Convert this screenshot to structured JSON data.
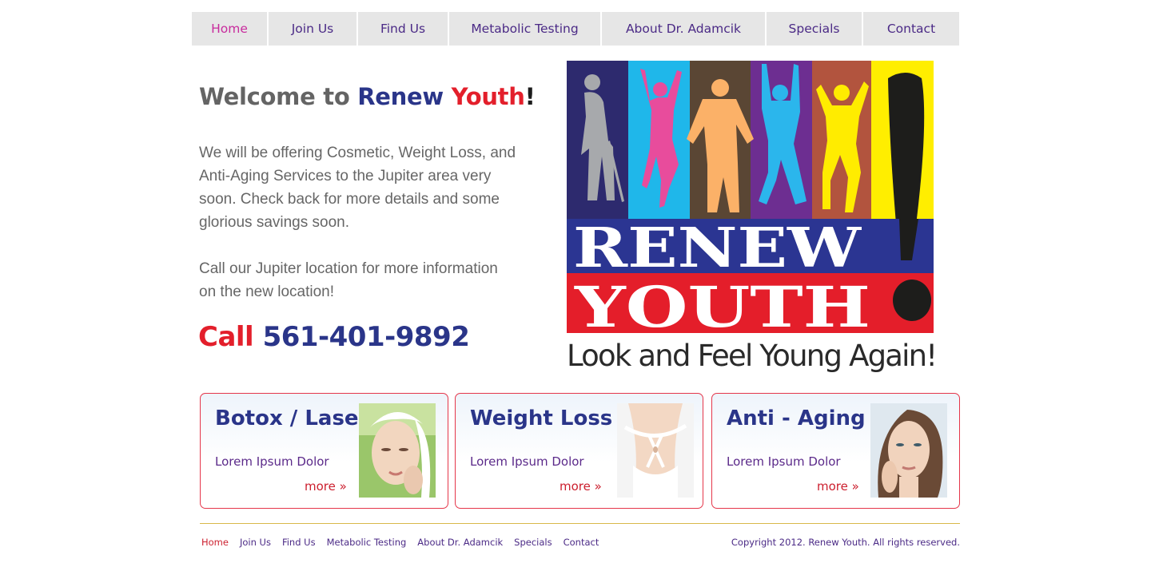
{
  "nav": {
    "items": [
      {
        "label": "Home",
        "active": true
      },
      {
        "label": "Join Us",
        "active": false
      },
      {
        "label": "Find Us",
        "active": false
      },
      {
        "label": "Metabolic Testing",
        "active": false
      },
      {
        "label": "About Dr. Adamcik",
        "active": false
      },
      {
        "label": "Specials",
        "active": false
      },
      {
        "label": "Contact",
        "active": false
      }
    ]
  },
  "welcome": {
    "prefix": "Welcome to ",
    "brand_blue": "Renew",
    "space": " ",
    "brand_red": "Youth",
    "suffix": "!"
  },
  "intro": {
    "paragraph1": "We will be offering Cosmetic, Weight Loss, and Anti-Aging Services to the Jupiter area very soon. Check back for more details and some glorious savings soon.",
    "paragraph2": "Call our Jupiter location for more information on the new location!"
  },
  "call": {
    "label": "Call",
    "phone": "561-401-9892"
  },
  "logo": {
    "word1": "RENEW",
    "word2": "YOUTH",
    "tagline": "Look and Feel Young Again!",
    "colors": [
      "#2d2a6e",
      "#1fb7ea",
      "#5a4634",
      "#6d2e91",
      "#b2543e",
      "#ffee00"
    ],
    "band_blue": "#2b3592",
    "band_red": "#e41e2a"
  },
  "cards": [
    {
      "title": "Botox / Laser",
      "text": "Lorem Ipsum Dolor",
      "more": "more »",
      "image": "woman-face-spa-image"
    },
    {
      "title": "Weight Loss",
      "text": "Lorem Ipsum Dolor",
      "more": "more »",
      "image": "measuring-tape-waist-image"
    },
    {
      "title": "Anti - Aging",
      "text": "Lorem Ipsum Dolor",
      "more": "more »",
      "image": "woman-face-portrait-image"
    }
  ],
  "footer": {
    "links": [
      {
        "label": "Home",
        "active": true
      },
      {
        "label": "Join Us",
        "active": false
      },
      {
        "label": "Find Us",
        "active": false
      },
      {
        "label": "Metabolic Testing",
        "active": false
      },
      {
        "label": "About Dr. Adamcik",
        "active": false
      },
      {
        "label": "Specials",
        "active": false
      },
      {
        "label": "Contact",
        "active": false
      }
    ],
    "copyright": "Copyright 2012. Renew Youth. All rights reserved."
  }
}
